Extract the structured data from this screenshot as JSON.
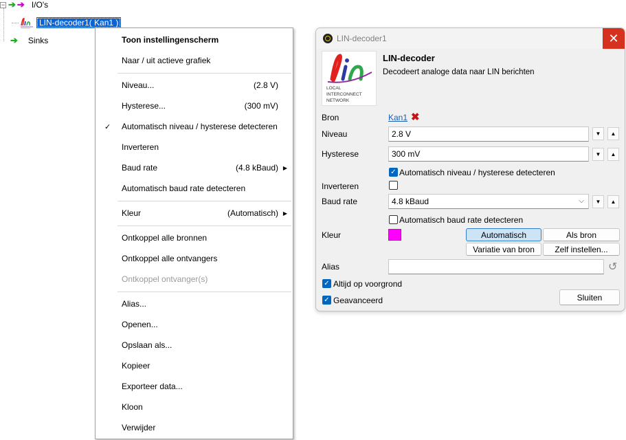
{
  "tree": {
    "ios_label": "I/O's",
    "decoder_label": "LIN-decoder1( Kan1 )",
    "sinks_label": "Sinks",
    "expander_minus": "⊟",
    "expander_plus": "⊞"
  },
  "menu": {
    "items": [
      {
        "label": "Toon instellingenscherm",
        "value": ""
      },
      {
        "label": "Naar / uit actieve grafiek",
        "value": ""
      },
      {
        "label": "Niveau...",
        "value": "(2.8 V)"
      },
      {
        "label": "Hysterese...",
        "value": "(300 mV)"
      },
      {
        "label": "Automatisch niveau / hysterese detecteren",
        "value": ""
      },
      {
        "label": "Inverteren",
        "value": ""
      },
      {
        "label": "Baud rate",
        "value": "(4.8 kBaud)"
      },
      {
        "label": "Automatisch baud rate detecteren",
        "value": ""
      },
      {
        "label": "Kleur",
        "value": "(Automatisch)"
      },
      {
        "label": "Ontkoppel alle bronnen",
        "value": ""
      },
      {
        "label": "Ontkoppel alle ontvangers",
        "value": ""
      },
      {
        "label": "Ontkoppel ontvanger(s)",
        "value": ""
      },
      {
        "label": "Alias...",
        "value": ""
      },
      {
        "label": "Openen...",
        "value": ""
      },
      {
        "label": "Opslaan als...",
        "value": ""
      },
      {
        "label": "Kopieer",
        "value": ""
      },
      {
        "label": "Exporteer data...",
        "value": ""
      },
      {
        "label": "Kloon",
        "value": ""
      },
      {
        "label": "Verwijder",
        "value": ""
      }
    ],
    "check_glyph": "✓",
    "submenu_glyph": "▶"
  },
  "dialog": {
    "title": "LIN-decoder1",
    "close_glyph": "✕",
    "logo": {
      "word": "lin",
      "line1": "LOCAL",
      "line2": "INTERCONNECT",
      "line3": "NETWORK"
    },
    "header_title": "LIN-decoder",
    "header_desc": "Decodeert analoge data naar LIN berichten",
    "bron_label": "Bron",
    "bron_value": "Kan1",
    "remove_glyph": "✖",
    "niveau_label": "Niveau",
    "niveau_value": "2.8 V",
    "hysterese_label": "Hysterese",
    "hysterese_value": "300 mV",
    "auto_level_label": "Automatisch niveau / hysterese detecteren",
    "auto_level_checked": true,
    "inverteren_label": "Inverteren",
    "inverteren_checked": false,
    "baud_label": "Baud rate",
    "baud_value": "4.8 kBaud",
    "auto_baud_label": "Automatisch baud rate detecteren",
    "auto_baud_checked": false,
    "kleur_label": "Kleur",
    "kleur_color": "#ff00ff",
    "btn_automatisch": "Automatisch",
    "btn_als_bron": "Als bron",
    "btn_variatie": "Variatie van bron",
    "btn_zelf": "Zelf instellen...",
    "alias_label": "Alias",
    "alias_value": "",
    "altijd_label": "Altijd op voorgrond",
    "altijd_checked": true,
    "geavanceerd_label": "Geavanceerd",
    "geavanceerd_checked": true,
    "sluiten_label": "Sluiten",
    "spin_down": "▼",
    "spin_up": "▲",
    "dropdown_glyph": "⌵",
    "reset_glyph": "↺",
    "checkmark": "✓"
  },
  "colors": {
    "selection": "#0a64d6",
    "close_red": "#d4321f",
    "link_blue": "#1a5fb4",
    "accent_checkbox": "#0067c0",
    "lin_red": "#e2211c",
    "lin_blue": "#2e3b9e",
    "lin_green": "#2ea84a",
    "lin_purple": "#8e2fa0"
  }
}
